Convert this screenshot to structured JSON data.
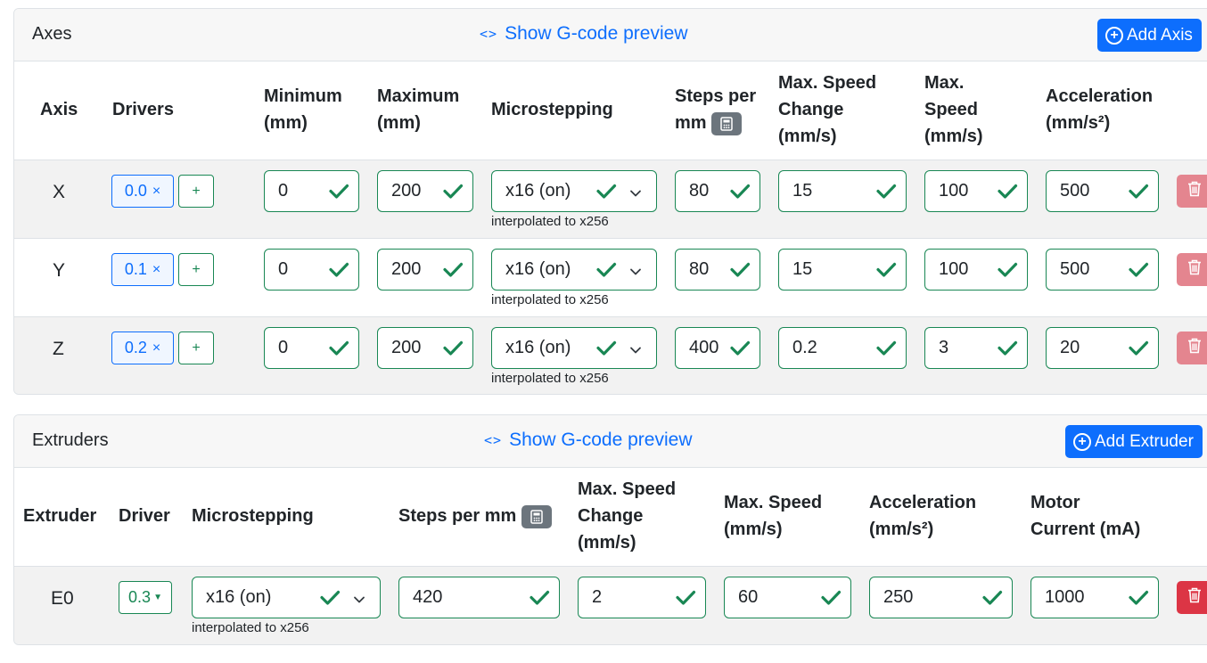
{
  "axes": {
    "title": "Axes",
    "gcode_link": "Show G-code preview",
    "add_button": "Add Axis",
    "headers": {
      "axis": "Axis",
      "drivers": "Drivers",
      "min_1": "Minimum",
      "min_2": "(mm)",
      "max_1": "Maximum",
      "max_2": "(mm)",
      "micro": "Microstepping",
      "steps_1": "Steps per",
      "steps_2": "mm",
      "jerk_1": "Max. Speed",
      "jerk_2": "Change",
      "jerk_3": "(mm/s)",
      "speed_1": "Max.",
      "speed_2": "Speed",
      "speed_3": "(mm/s)",
      "accel_1": "Acceleration",
      "accel_2": "(mm/s²)"
    },
    "rows": [
      {
        "axis": "X",
        "driver": "0.0",
        "min": "0",
        "max": "200",
        "micro": "x16 (on)",
        "hint": "interpolated to x256",
        "steps": "80",
        "jerk": "15",
        "speed": "100",
        "accel": "500"
      },
      {
        "axis": "Y",
        "driver": "0.1",
        "min": "0",
        "max": "200",
        "micro": "x16 (on)",
        "hint": "interpolated to x256",
        "steps": "80",
        "jerk": "15",
        "speed": "100",
        "accel": "500"
      },
      {
        "axis": "Z",
        "driver": "0.2",
        "min": "0",
        "max": "200",
        "micro": "x16 (on)",
        "hint": "interpolated to x256",
        "steps": "400",
        "jerk": "0.2",
        "speed": "3",
        "accel": "20"
      }
    ],
    "remove_symbol": "×",
    "add_driver_symbol": "+"
  },
  "extruders": {
    "title": "Extruders",
    "gcode_link": "Show G-code preview",
    "add_button": "Add Extruder",
    "headers": {
      "extruder": "Extruder",
      "driver": "Driver",
      "micro": "Microstepping",
      "steps": "Steps per mm",
      "jerk_1": "Max. Speed",
      "jerk_2": "Change",
      "jerk_3": "(mm/s)",
      "speed_1": "Max. Speed",
      "speed_2": "(mm/s)",
      "accel_1": "Acceleration",
      "accel_2": "(mm/s²)",
      "current_1": "Motor",
      "current_2": "Current (mA)"
    },
    "rows": [
      {
        "name": "E0",
        "driver": "0.3",
        "micro": "x16 (on)",
        "hint": "interpolated to x256",
        "steps": "420",
        "jerk": "2",
        "speed": "60",
        "accel": "250",
        "current": "1000"
      }
    ]
  },
  "colors": {
    "primary": "#0d6efd",
    "success": "#198754",
    "danger": "#dc3545",
    "secondary": "#6c757d"
  },
  "icons": [
    "code-icon",
    "plus-circle-icon",
    "calculator-icon",
    "check-icon",
    "chevron-down-icon",
    "trash-icon",
    "caret-down-icon"
  ]
}
